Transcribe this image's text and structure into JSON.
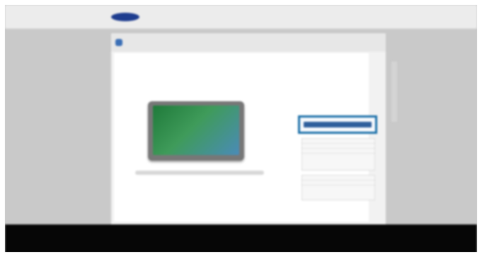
{
  "header": {
    "logo_text": "",
    "brand_text": "",
    "nav": [
      "",
      "",
      ""
    ],
    "top_link": ""
  },
  "breadcrumb": {
    "label": ""
  },
  "main": {
    "page_title": "",
    "device_caption": ""
  },
  "product": {
    "title": "",
    "model": "",
    "price_note": "",
    "description": "",
    "download_label": "",
    "options_group1": [
      "",
      "",
      ""
    ],
    "options_group2": [
      "",
      ""
    ]
  },
  "footer": {
    "title": "",
    "line1": "",
    "line2": ""
  },
  "colors": {
    "accent": "#1a6fa8",
    "brand_blue": "#1e3d8f",
    "button": "#2e5f9c",
    "footer_bg": "#060606",
    "device_green": "#2f8a4a"
  }
}
